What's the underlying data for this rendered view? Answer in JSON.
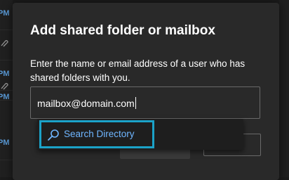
{
  "background": {
    "rows": [
      {
        "time": "PM"
      },
      {
        "time": ""
      },
      {
        "time": "PM"
      },
      {
        "time": ""
      },
      {
        "time": "PM"
      },
      {
        "time": "PM"
      }
    ]
  },
  "dialog": {
    "title": "Add shared folder or mailbox",
    "description": "Enter the name or email address of a user who has shared folders with you.",
    "input": {
      "value": "mailbox@domain.com"
    },
    "suggestion": {
      "icon": "search-icon",
      "label": "Search Directory"
    }
  },
  "colors": {
    "accent": "#1ba2c8",
    "link": "#6fb6ff",
    "dialog_bg": "#292929"
  }
}
